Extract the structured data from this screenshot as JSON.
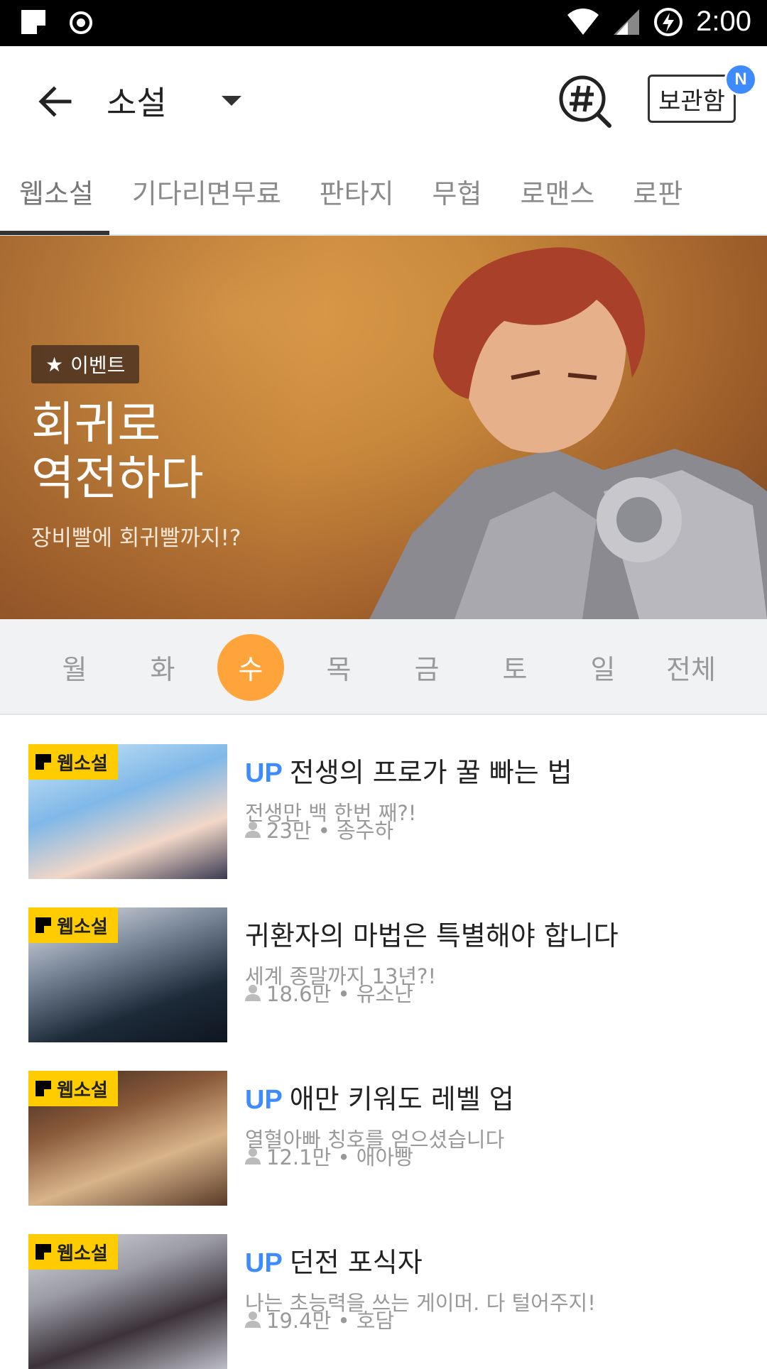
{
  "status": {
    "time": "2:00"
  },
  "header": {
    "title": "소설",
    "storage_label": "보관함",
    "badge": "N"
  },
  "tabs": [
    "웹소설",
    "기다리면무료",
    "판타지",
    "무협",
    "로맨스",
    "로판"
  ],
  "banner": {
    "tag": "이벤트",
    "title": "회귀로\n역전하다",
    "subtitle": "장비빨에 회귀빨까지!?"
  },
  "days": [
    "월",
    "화",
    "수",
    "목",
    "금",
    "토",
    "일",
    "전체"
  ],
  "list": [
    {
      "tag": "웹소설",
      "up": "UP",
      "title": "전생의 프로가 꿀 빠는 법",
      "desc": "전생만 백 한번 째?!",
      "meta": "23만 • 송수하"
    },
    {
      "tag": "웹소설",
      "up": "",
      "title": "귀환자의 마법은 특별해야 합니다",
      "desc": "세계 종말까지 13년?!",
      "meta": "18.6만 • 유소난"
    },
    {
      "tag": "웹소설",
      "up": "UP",
      "title": "애만 키워도 레벨 업",
      "desc": "열혈아빠 칭호를 얻으셨습니다",
      "meta": "12.1만 • 애아빵"
    },
    {
      "tag": "웹소설",
      "up": "UP",
      "title": "던전 포식자",
      "desc": "나는 초능력을 쓰는 게이머. 다 털어주지!",
      "meta": "19.4만 • 호담"
    }
  ],
  "colors": {
    "accent": "#ffa43a",
    "up": "#3d8bff",
    "tag": "#ffcc00"
  }
}
